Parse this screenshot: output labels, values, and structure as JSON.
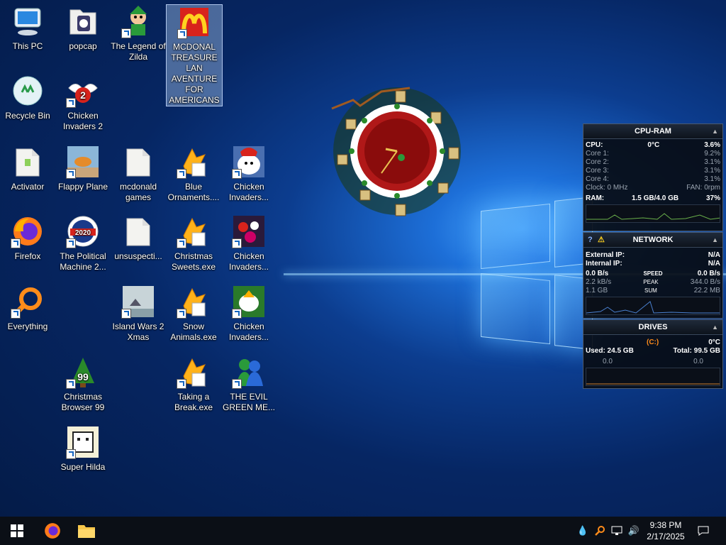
{
  "desktop": {
    "icons": {
      "this_pc": "This PC",
      "popcap": "popcap",
      "legend_zilda": "The Legend of Zilda",
      "mcdonal": "MCDONAL TREASURE LAN AVENTURE FOR AMERICANS",
      "recycle_bin": "Recycle Bin",
      "chicken_invaders_2": "Chicken Invaders 2",
      "activator": "Activator",
      "flappy_plane": "Flappy Plane",
      "mcdonald_games": "mcdonald games",
      "blue_ornaments": "Blue Ornaments....",
      "chicken_invaders_a": "Chicken Invaders...",
      "firefox": "Firefox",
      "political_machine": "The Political Machine 2...",
      "unsuspecti": "unsuspecti...",
      "christmas_sweets": "Christmas Sweets.exe",
      "chicken_invaders_b": "Chicken Invaders...",
      "everything": "Everything",
      "island_wars": "Island Wars 2 Xmas",
      "snow_animals": "Snow Animals.exe",
      "chicken_invaders_c": "Chicken Invaders...",
      "christmas_browser": "Christmas Browser 99",
      "taking_break": "Taking a Break.exe",
      "evil_green": "THE EVIL GREEN ME...",
      "super_hilda": "Super Hilda"
    },
    "badges": {
      "political_2020": "2020",
      "browser_99": "99",
      "chicken_2": "2"
    }
  },
  "cpu_ram": {
    "title": "CPU-RAM",
    "cpu_label": "CPU:",
    "cpu_temp": "0°C",
    "cpu_pct": "3.6%",
    "cores": [
      {
        "label": "Core 1:",
        "value": "9.2%"
      },
      {
        "label": "Core 2:",
        "value": "3.1%"
      },
      {
        "label": "Core 3:",
        "value": "3.1%"
      },
      {
        "label": "Core 4:",
        "value": "3.1%"
      }
    ],
    "clock": "Clock: 0 MHz",
    "fan": "FAN: 0rpm",
    "ram_label": "RAM:",
    "ram_value": "1.5 GB/4.0 GB",
    "ram_pct": "37%"
  },
  "network": {
    "title": "NETWORK",
    "help": "?",
    "warn": "⚠",
    "external_label": "External IP:",
    "external_value": "N/A",
    "internal_label": "Internal IP:",
    "internal_value": "N/A",
    "speed_left": "0.0 B/s",
    "speed_label": "SPEED",
    "speed_right": "0.0 B/s",
    "peak_left": "2.2 kB/s",
    "peak_label": "PEAK",
    "peak_right": "344.0 B/s",
    "sum_left": "1.1 GB",
    "sum_label": "SUM",
    "sum_right": "22.2 MB"
  },
  "drives": {
    "title": "DRIVES",
    "drive_letter": "(C:)",
    "temp": "0°C",
    "used": "Used: 24.5 GB",
    "total": "Total: 99.5 GB",
    "read": "0.0",
    "write": "0.0"
  },
  "taskbar": {
    "time": "9:38 PM",
    "date": "2/17/2025"
  },
  "colors": {
    "accent_orange": "#ff8c1a",
    "widget_bg": "#080c14"
  }
}
